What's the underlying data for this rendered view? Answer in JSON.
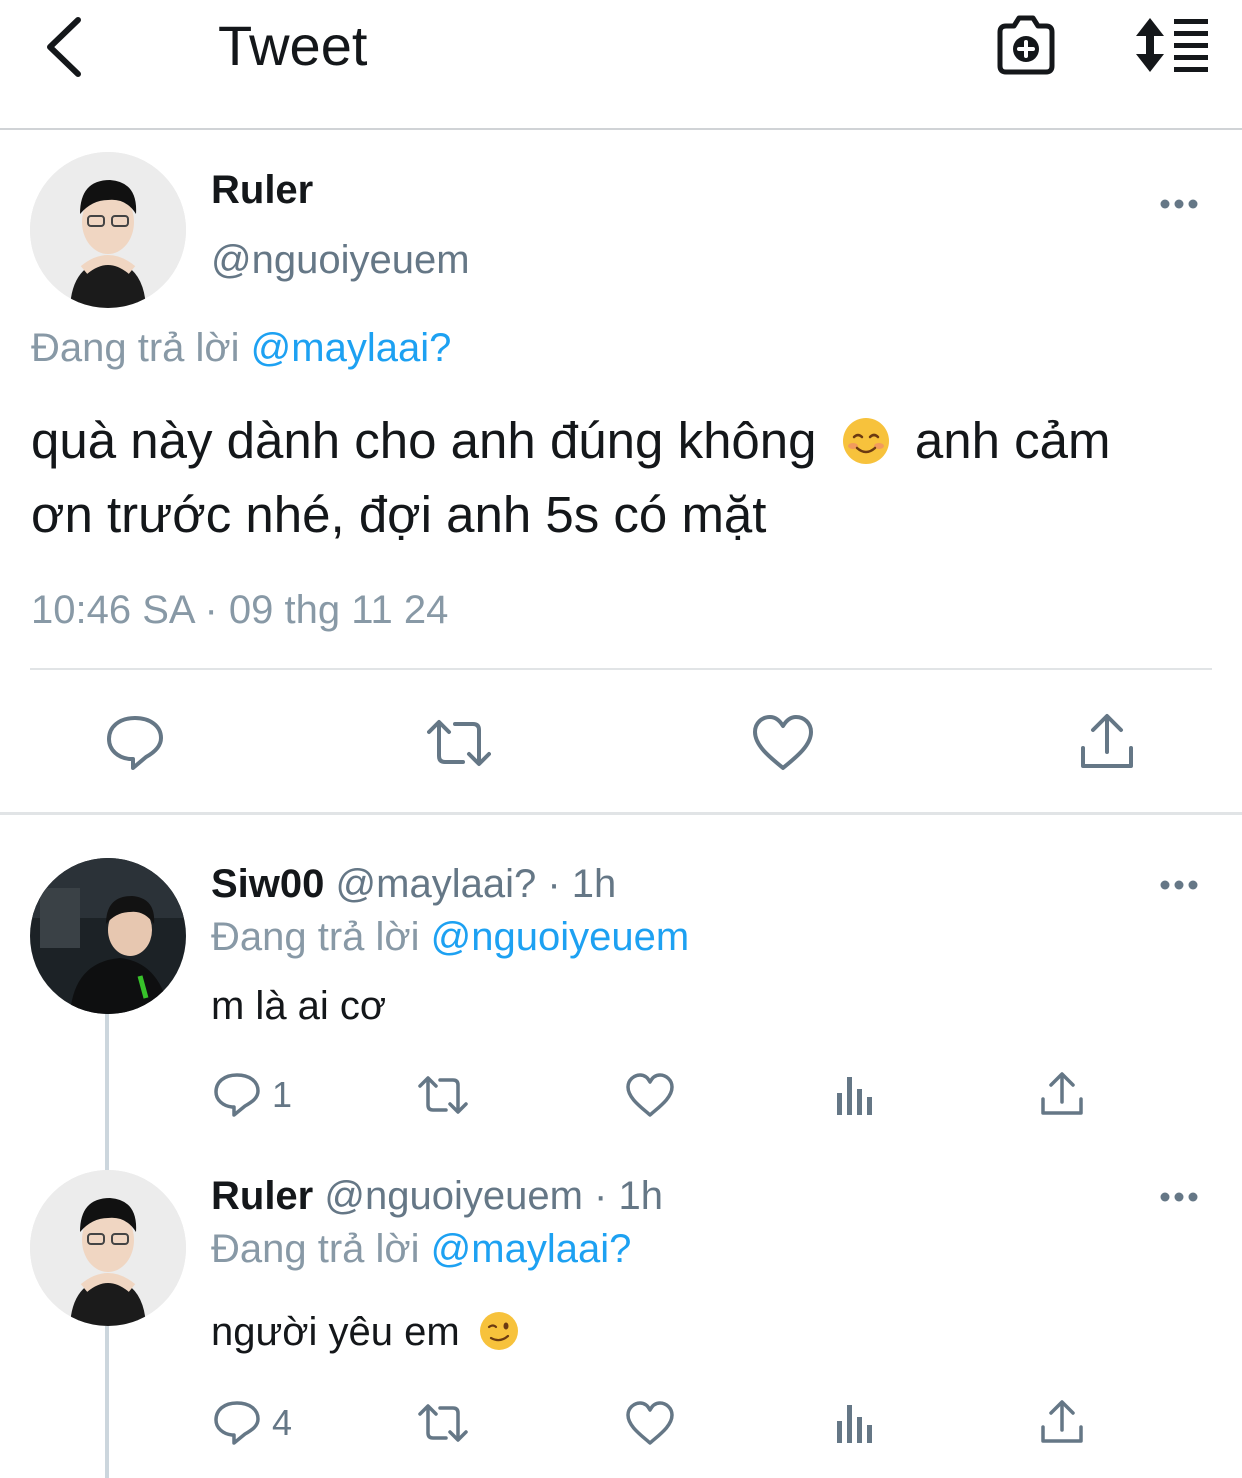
{
  "header": {
    "title": "Tweet",
    "icons": [
      "back-chevron-icon",
      "camera-plus-icon",
      "sort-toggle-icon"
    ]
  },
  "main_tweet": {
    "name": "Ruler",
    "handle": "@nguoiyeuem",
    "replying_prefix": "Đang trả lời",
    "replying_to": "@maylaai?",
    "text_line1": "quà này dành cho anh đúng không",
    "text_line1_rest": "anh cảm",
    "text_line2": "ơn trước nhé, đợi anh 5s có mặt",
    "timestamp": "10:46 SA · 09 thg 11 24"
  },
  "replies": [
    {
      "name": "Siw00",
      "handle": "@maylaai?",
      "time": "· 1h",
      "replying_prefix": "Đang trả lời",
      "replying_to": "@nguoiyeuem",
      "text": "m là ai cơ",
      "reply_count": "1"
    },
    {
      "name": "Ruler",
      "handle": "@nguoiyeuem",
      "time": "· 1h",
      "replying_prefix": "Đang trả lời",
      "replying_to": "@maylaai?",
      "text": "người yêu em",
      "reply_count": "4"
    }
  ],
  "colors": {
    "accent": "#1da1f2",
    "secondary_text": "#657786",
    "muted_text": "#8899a6",
    "icon": "#657786",
    "divider": "#e1e4e6"
  }
}
